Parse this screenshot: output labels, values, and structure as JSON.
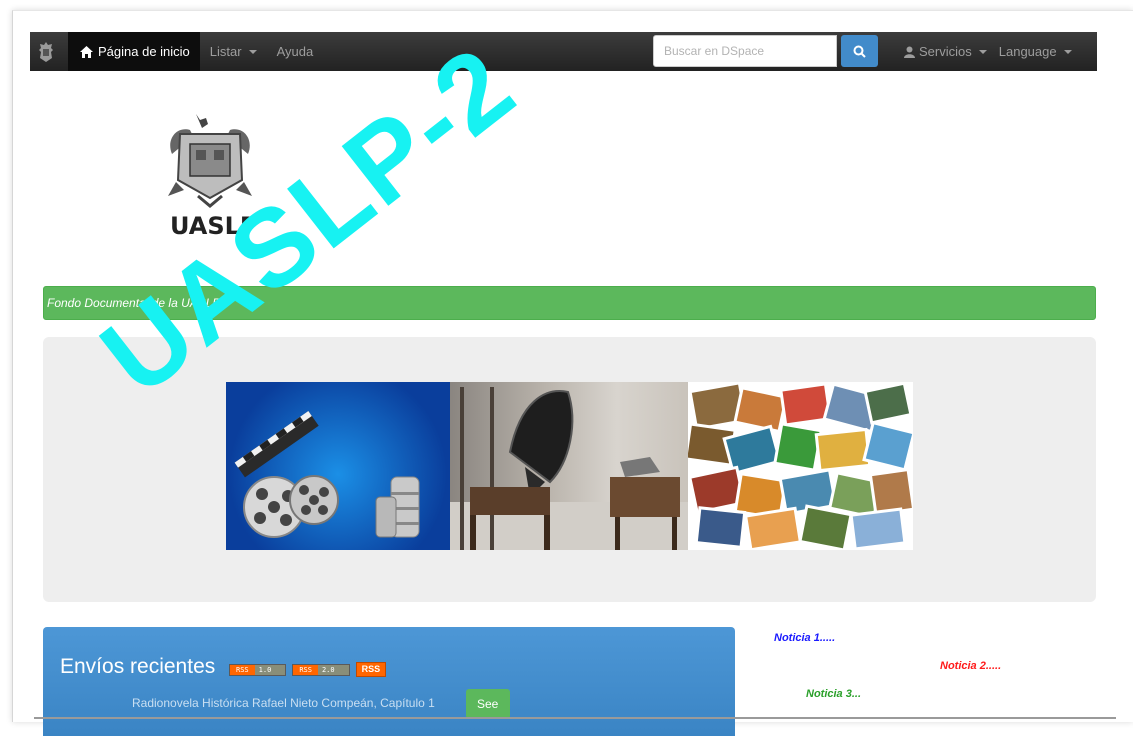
{
  "navbar": {
    "home_label": "Página de inicio",
    "menu_listar": "Listar",
    "menu_ayuda": "Ayuda",
    "search_placeholder": "Buscar en DSpace",
    "menu_servicios": "Servicios",
    "menu_language": "Language"
  },
  "logo": {
    "text": "UASLP"
  },
  "banner_bar": {
    "text": "Fondo Documental de la UASLP"
  },
  "recent": {
    "title": "Envíos recientes",
    "rss1_left": "RSS",
    "rss1_right": "1.0",
    "rss2_left": "RSS",
    "rss2_right": "2.0",
    "rss_atom": "RSS",
    "item_title": "Radionovela Histórica Rafael Nieto Compeán, Capítulo 1",
    "see_label": "See"
  },
  "news": {
    "item1": "Noticia 1.....",
    "item2": "Noticia 2.....",
    "item3": "Noticia 3..."
  },
  "watermark": {
    "text": "UASLP-2"
  },
  "colors": {
    "navbar": "#222222",
    "search_button": "#428bca",
    "green_bar": "#5cb85c",
    "recent_panel": "#428bca",
    "watermark": "#17f2f2"
  }
}
